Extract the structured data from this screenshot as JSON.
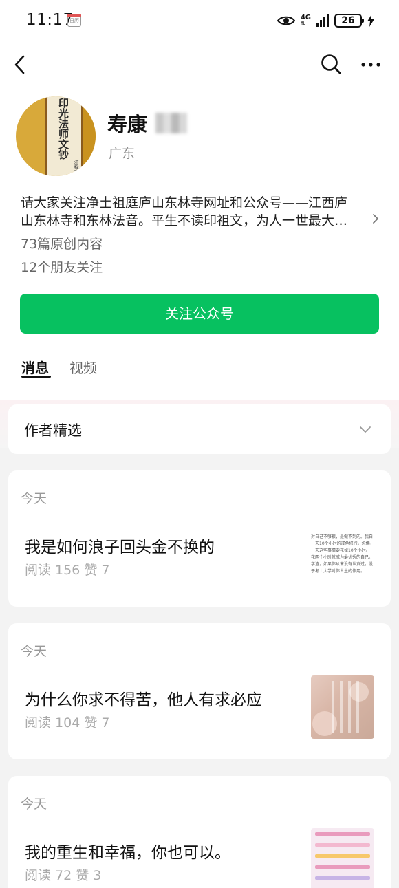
{
  "status": {
    "time": "11:17",
    "calendar_label": "日历",
    "network": "4G",
    "battery": "26"
  },
  "nav": {
    "back": "back-icon",
    "search": "search-icon",
    "more": "more-icon"
  },
  "profile": {
    "avatar_title": "印光法师文钞",
    "avatar_subtitle": "注释本",
    "name": "寿康",
    "region": "广东",
    "description_line1": "请大家关注净土祖庭庐山东林寺网址和公众号——江西庐",
    "description_line2": "山东林寺和东林法音。平生不读印祖文，为人一世最大…",
    "original_count": "73篇原创内容",
    "friends_following": "12个朋友关注",
    "follow_button": "关注公众号"
  },
  "tabs": [
    {
      "label": "消息",
      "active": true
    },
    {
      "label": "视频",
      "active": false
    }
  ],
  "featured": {
    "title": "作者精选"
  },
  "articles": [
    {
      "date": "今天",
      "title": "我是如何浪子回头金不换的",
      "stats": "阅读 156   赞 7",
      "thumb_lines": [
        "对自己不够狠，是做不到的。我自",
        "一天10个小时的戒色修行。念佛，",
        "一天这些事情要花掉10个小时。",
        "花两个小时就成为最优秀的自己。",
        "学渣，如果你从末没有认真过，没",
        "于考上大学对你人生的作用。"
      ]
    },
    {
      "date": "今天",
      "title": "为什么你求不得苦，他人有求必应",
      "stats": "阅读 104   赞 7"
    },
    {
      "date": "今天",
      "title": "我的重生和幸福，你也可以。",
      "stats": "阅读 72   赞 3"
    }
  ],
  "colors": {
    "accent": "#07c160",
    "page_bg": "#f3f3f3"
  }
}
